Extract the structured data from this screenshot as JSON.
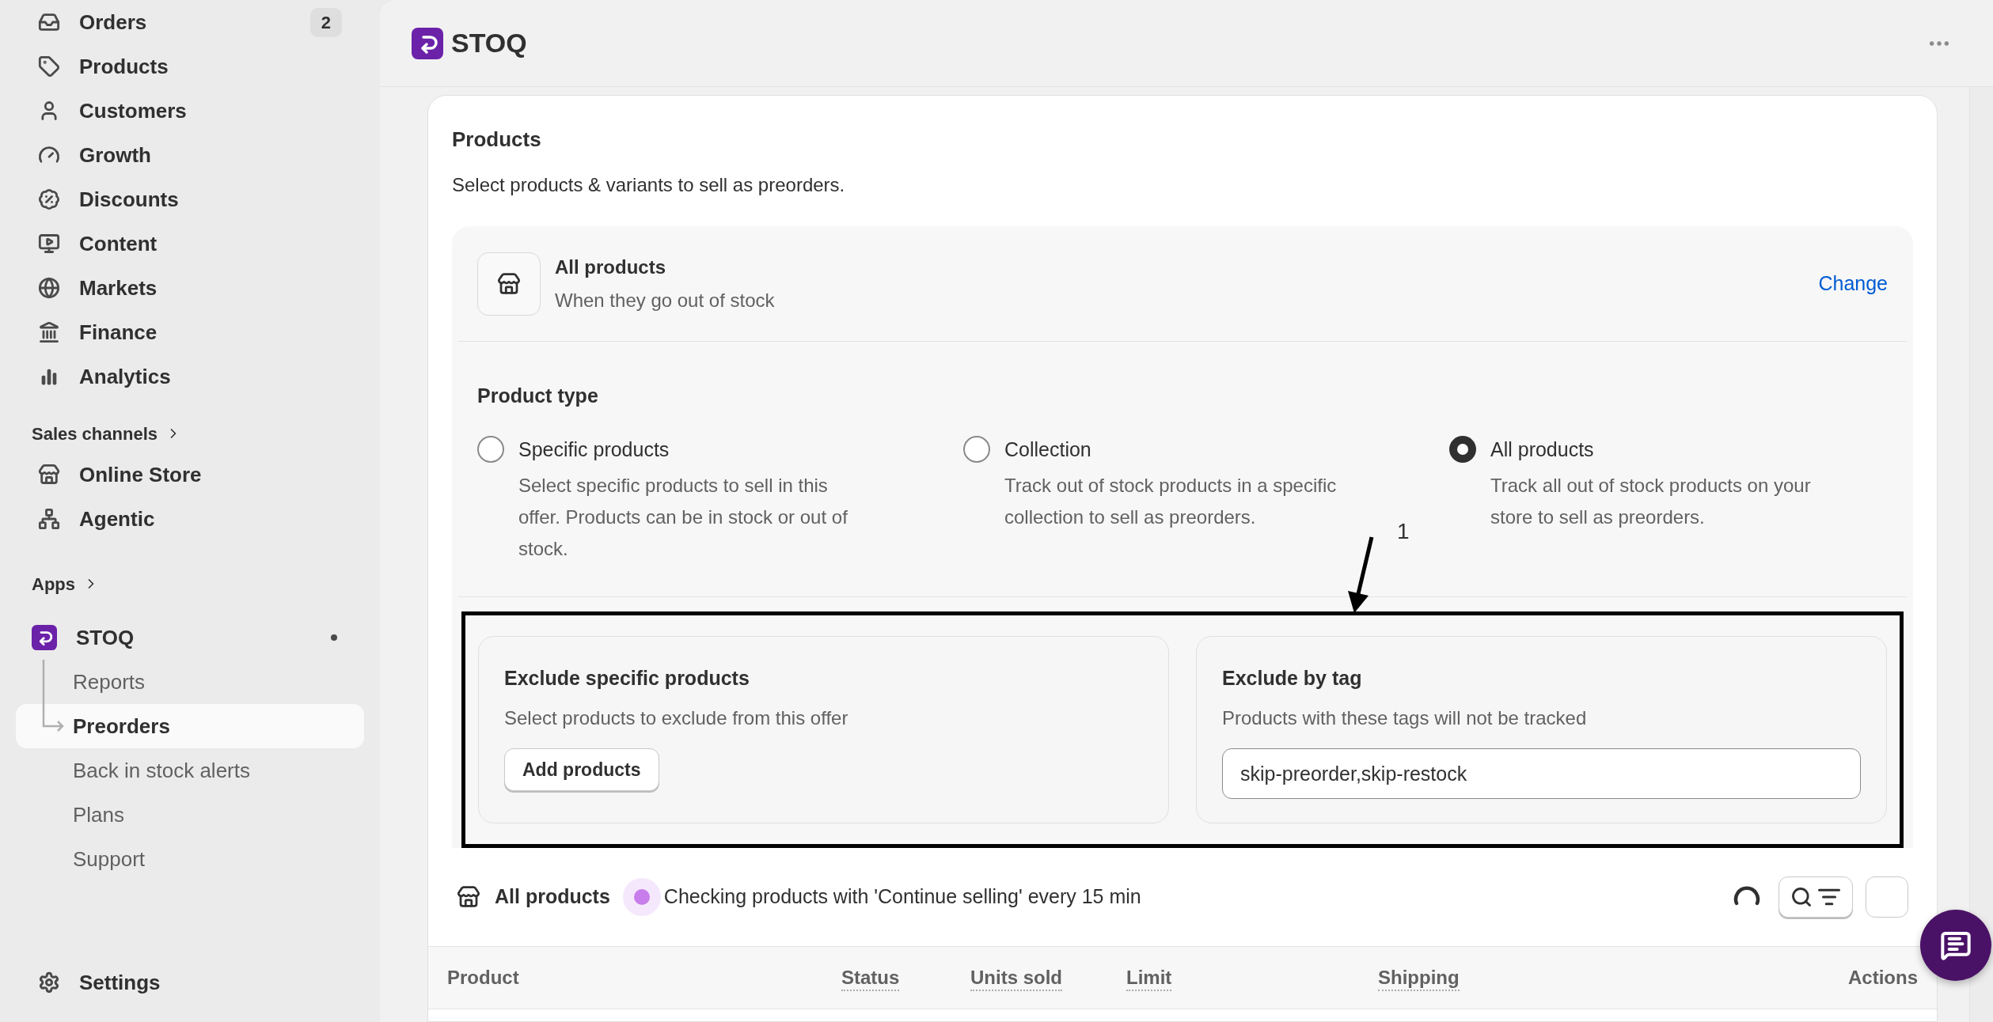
{
  "sidebar": {
    "nav": [
      {
        "label": "Orders",
        "badge": "2",
        "selected": false
      },
      {
        "label": "Products",
        "selected": false
      },
      {
        "label": "Customers",
        "selected": false
      },
      {
        "label": "Growth",
        "selected": false
      },
      {
        "label": "Discounts",
        "selected": false
      },
      {
        "label": "Content",
        "selected": false
      },
      {
        "label": "Markets",
        "selected": false
      },
      {
        "label": "Finance",
        "selected": false
      },
      {
        "label": "Analytics",
        "selected": false
      }
    ],
    "sales_channels": {
      "heading": "Sales channels",
      "items": [
        {
          "label": "Online Store",
          "selected": false
        },
        {
          "label": "Agentic",
          "selected": false
        }
      ]
    },
    "apps": {
      "heading": "Apps",
      "app": {
        "label": "STOQ",
        "unread": true,
        "children": [
          {
            "label": "Reports",
            "selected": false
          },
          {
            "label": "Preorders",
            "selected": true
          },
          {
            "label": "Back in stock alerts",
            "selected": false
          },
          {
            "label": "Plans",
            "selected": false
          },
          {
            "label": "Support",
            "selected": false
          }
        ]
      }
    },
    "settings": "Settings"
  },
  "header": {
    "app_name": "STOQ"
  },
  "card": {
    "title": "Products",
    "subtitle": "Select products & variants to sell as preorders.",
    "selection": {
      "title": "All products",
      "subtitle": "When they go out of stock",
      "action": "Change"
    },
    "product_type": {
      "label": "Product type",
      "options": [
        {
          "label": "Specific products",
          "description": "Select specific products to sell in this offer. Products can be in stock or out of stock.",
          "selected": false
        },
        {
          "label": "Collection",
          "description": "Track out of stock products in a specific collection to sell as preorders.",
          "selected": false
        },
        {
          "label": "All products",
          "description": "Track all out of stock products on your store to sell as preorders.",
          "selected": true
        }
      ]
    },
    "exclusions": [
      {
        "kind": "button",
        "title": "Exclude specific products",
        "description": "Select products to exclude from this offer",
        "button": "Add products"
      },
      {
        "kind": "field",
        "title": "Exclude by tag",
        "description": "Products with these tags will not be tracked",
        "value": "skip-preorder,skip-restock"
      }
    ],
    "annotation": {
      "label": "1"
    },
    "list": {
      "title": "All products",
      "status": "Checking products with 'Continue selling' every 15 min",
      "columns": [
        {
          "label": "Product",
          "tooltip": false
        },
        {
          "label": "Status",
          "tooltip": true
        },
        {
          "label": "Units sold",
          "tooltip": true
        },
        {
          "label": "Limit",
          "tooltip": true
        },
        {
          "label": "Shipping",
          "tooltip": true
        },
        {
          "label": "Actions",
          "tooltip": false
        }
      ]
    }
  }
}
